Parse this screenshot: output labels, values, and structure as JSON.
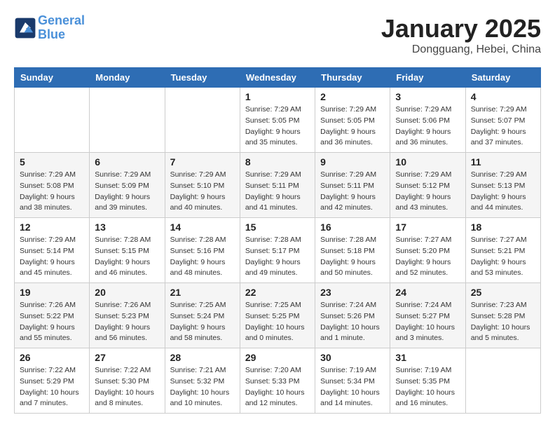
{
  "header": {
    "logo_line1": "General",
    "logo_line2": "Blue",
    "month": "January 2025",
    "location": "Dongguang, Hebei, China"
  },
  "days_of_week": [
    "Sunday",
    "Monday",
    "Tuesday",
    "Wednesday",
    "Thursday",
    "Friday",
    "Saturday"
  ],
  "weeks": [
    [
      {
        "day": "",
        "info": ""
      },
      {
        "day": "",
        "info": ""
      },
      {
        "day": "",
        "info": ""
      },
      {
        "day": "1",
        "info": "Sunrise: 7:29 AM\nSunset: 5:05 PM\nDaylight: 9 hours\nand 35 minutes."
      },
      {
        "day": "2",
        "info": "Sunrise: 7:29 AM\nSunset: 5:05 PM\nDaylight: 9 hours\nand 36 minutes."
      },
      {
        "day": "3",
        "info": "Sunrise: 7:29 AM\nSunset: 5:06 PM\nDaylight: 9 hours\nand 36 minutes."
      },
      {
        "day": "4",
        "info": "Sunrise: 7:29 AM\nSunset: 5:07 PM\nDaylight: 9 hours\nand 37 minutes."
      }
    ],
    [
      {
        "day": "5",
        "info": "Sunrise: 7:29 AM\nSunset: 5:08 PM\nDaylight: 9 hours\nand 38 minutes."
      },
      {
        "day": "6",
        "info": "Sunrise: 7:29 AM\nSunset: 5:09 PM\nDaylight: 9 hours\nand 39 minutes."
      },
      {
        "day": "7",
        "info": "Sunrise: 7:29 AM\nSunset: 5:10 PM\nDaylight: 9 hours\nand 40 minutes."
      },
      {
        "day": "8",
        "info": "Sunrise: 7:29 AM\nSunset: 5:11 PM\nDaylight: 9 hours\nand 41 minutes."
      },
      {
        "day": "9",
        "info": "Sunrise: 7:29 AM\nSunset: 5:11 PM\nDaylight: 9 hours\nand 42 minutes."
      },
      {
        "day": "10",
        "info": "Sunrise: 7:29 AM\nSunset: 5:12 PM\nDaylight: 9 hours\nand 43 minutes."
      },
      {
        "day": "11",
        "info": "Sunrise: 7:29 AM\nSunset: 5:13 PM\nDaylight: 9 hours\nand 44 minutes."
      }
    ],
    [
      {
        "day": "12",
        "info": "Sunrise: 7:29 AM\nSunset: 5:14 PM\nDaylight: 9 hours\nand 45 minutes."
      },
      {
        "day": "13",
        "info": "Sunrise: 7:28 AM\nSunset: 5:15 PM\nDaylight: 9 hours\nand 46 minutes."
      },
      {
        "day": "14",
        "info": "Sunrise: 7:28 AM\nSunset: 5:16 PM\nDaylight: 9 hours\nand 48 minutes."
      },
      {
        "day": "15",
        "info": "Sunrise: 7:28 AM\nSunset: 5:17 PM\nDaylight: 9 hours\nand 49 minutes."
      },
      {
        "day": "16",
        "info": "Sunrise: 7:28 AM\nSunset: 5:18 PM\nDaylight: 9 hours\nand 50 minutes."
      },
      {
        "day": "17",
        "info": "Sunrise: 7:27 AM\nSunset: 5:20 PM\nDaylight: 9 hours\nand 52 minutes."
      },
      {
        "day": "18",
        "info": "Sunrise: 7:27 AM\nSunset: 5:21 PM\nDaylight: 9 hours\nand 53 minutes."
      }
    ],
    [
      {
        "day": "19",
        "info": "Sunrise: 7:26 AM\nSunset: 5:22 PM\nDaylight: 9 hours\nand 55 minutes."
      },
      {
        "day": "20",
        "info": "Sunrise: 7:26 AM\nSunset: 5:23 PM\nDaylight: 9 hours\nand 56 minutes."
      },
      {
        "day": "21",
        "info": "Sunrise: 7:25 AM\nSunset: 5:24 PM\nDaylight: 9 hours\nand 58 minutes."
      },
      {
        "day": "22",
        "info": "Sunrise: 7:25 AM\nSunset: 5:25 PM\nDaylight: 10 hours\nand 0 minutes."
      },
      {
        "day": "23",
        "info": "Sunrise: 7:24 AM\nSunset: 5:26 PM\nDaylight: 10 hours\nand 1 minute."
      },
      {
        "day": "24",
        "info": "Sunrise: 7:24 AM\nSunset: 5:27 PM\nDaylight: 10 hours\nand 3 minutes."
      },
      {
        "day": "25",
        "info": "Sunrise: 7:23 AM\nSunset: 5:28 PM\nDaylight: 10 hours\nand 5 minutes."
      }
    ],
    [
      {
        "day": "26",
        "info": "Sunrise: 7:22 AM\nSunset: 5:29 PM\nDaylight: 10 hours\nand 7 minutes."
      },
      {
        "day": "27",
        "info": "Sunrise: 7:22 AM\nSunset: 5:30 PM\nDaylight: 10 hours\nand 8 minutes."
      },
      {
        "day": "28",
        "info": "Sunrise: 7:21 AM\nSunset: 5:32 PM\nDaylight: 10 hours\nand 10 minutes."
      },
      {
        "day": "29",
        "info": "Sunrise: 7:20 AM\nSunset: 5:33 PM\nDaylight: 10 hours\nand 12 minutes."
      },
      {
        "day": "30",
        "info": "Sunrise: 7:19 AM\nSunset: 5:34 PM\nDaylight: 10 hours\nand 14 minutes."
      },
      {
        "day": "31",
        "info": "Sunrise: 7:19 AM\nSunset: 5:35 PM\nDaylight: 10 hours\nand 16 minutes."
      },
      {
        "day": "",
        "info": ""
      }
    ]
  ]
}
